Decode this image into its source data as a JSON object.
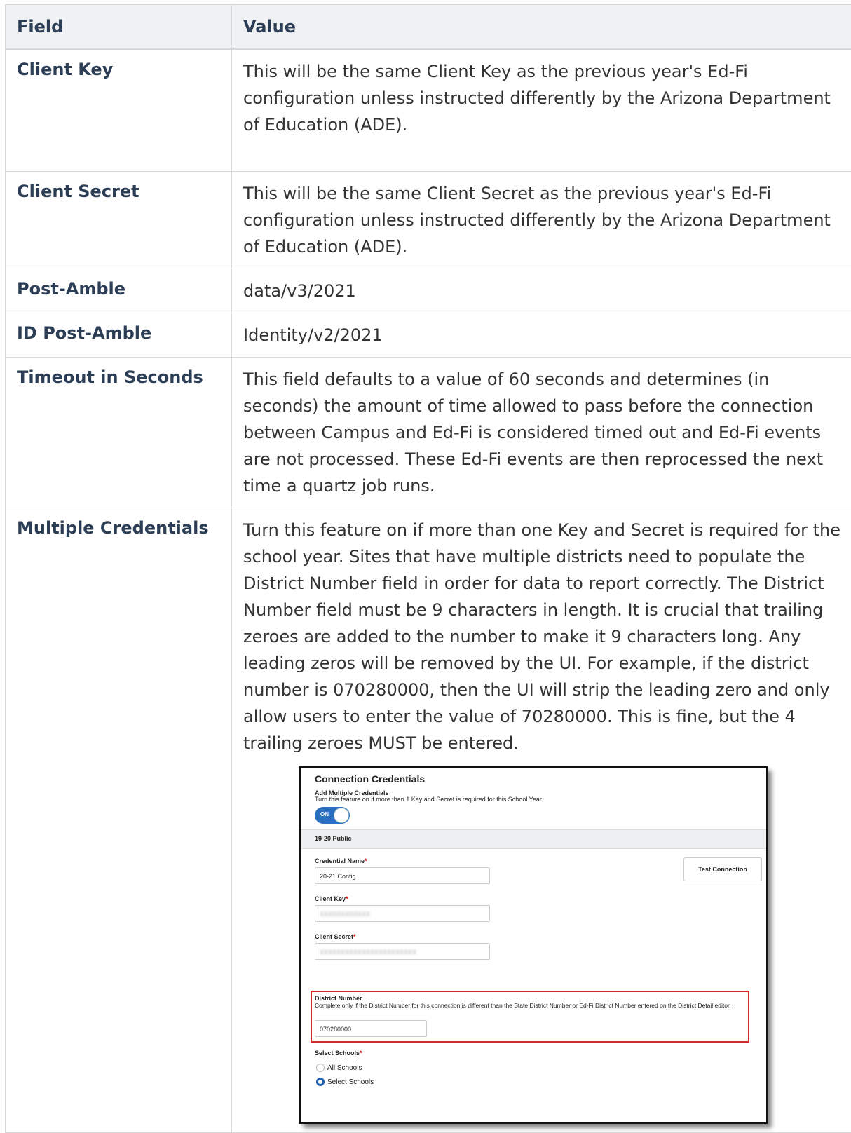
{
  "table": {
    "headers": [
      "Field",
      "Value"
    ],
    "rows": [
      {
        "field": "Client Key",
        "value": "This will be the same Client Key as the previous year's Ed-Fi configuration unless instructed differently by the Arizona Department of Education (ADE)."
      },
      {
        "field": "Client Secret",
        "value": "This will be the same Client Secret as the previous year's Ed-Fi configuration unless instructed differently by the Arizona Department of Education (ADE)."
      },
      {
        "field": "Post-Amble",
        "value": "data/v3/2021"
      },
      {
        "field": "ID Post-Amble",
        "value": "Identity/v2/2021"
      },
      {
        "field": "Timeout in Seconds",
        "value": "This field defaults to a value of 60 seconds and determines (in seconds) the amount of time allowed to pass before the connection between Campus and Ed-Fi is considered timed out and Ed-Fi events are not processed. These Ed-Fi events are then reprocessed the next time a quartz job runs."
      },
      {
        "field": "Multiple Credentials",
        "value": "Turn this feature on if more than one Key and Secret is required for the school year. Sites that have multiple districts need to populate the District Number field in order for data to report correctly. The District Number field must be 9 characters in length. It is crucial that trailing zeroes are added to the number to make it 9 characters long. Any leading zeros will be removed by the UI. For example, if the district number is 070280000, then the UI will strip the leading zero and only allow users to enter the value of 70280000. This is fine, but the 4 trailing zeroes MUST be entered."
      }
    ]
  },
  "screenshot": {
    "title": "Connection Credentials",
    "add_multiple_label": "Add Multiple Credentials",
    "add_multiple_desc": "Turn this feature on if more than 1 Key and Secret is required for this School Year.",
    "toggle_label": "ON",
    "section_title": "19-20 Public",
    "credential_name_label": "Credential Name",
    "credential_name_value": "20-21 Config",
    "test_connection_label": "Test Connection",
    "client_key_label": "Client Key",
    "client_key_value": "XXXXXXXXXXXX",
    "client_secret_label": "Client Secret",
    "client_secret_value": "XXXXXXXXXXXXXXXXXXXXXXX",
    "district_number_label": "District Number",
    "district_number_desc": "Complete only if the District Number for this connection is different than the State District Number or Ed-Fi District Number entered on the District Detail editor.",
    "district_number_value": "070280000",
    "select_schools_label": "Select Schools",
    "required_mark": "*",
    "options": [
      "All Schools",
      "Select Schools"
    ],
    "selected_option": "Select Schools"
  }
}
